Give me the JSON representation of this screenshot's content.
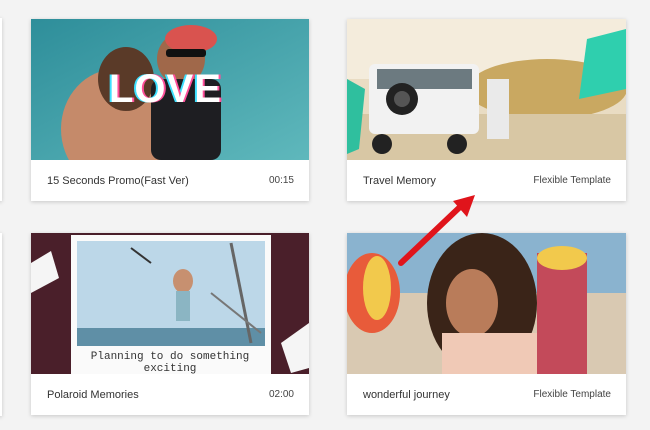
{
  "cards": [
    {
      "title": "15 Seconds Promo(Fast Ver)",
      "meta": "00:15",
      "overlay_text": "LOVE"
    },
    {
      "title": "Travel Memory",
      "meta": "Flexible Template"
    },
    {
      "title": "Polaroid Memories",
      "meta": "02:00",
      "overlay_text": "Planning to do something exciting"
    },
    {
      "title": "wonderful journey",
      "meta": "Flexible Template"
    }
  ],
  "colors": {
    "background": "#f3f3f3",
    "card": "#ffffff",
    "arrow": "#e0141b"
  }
}
